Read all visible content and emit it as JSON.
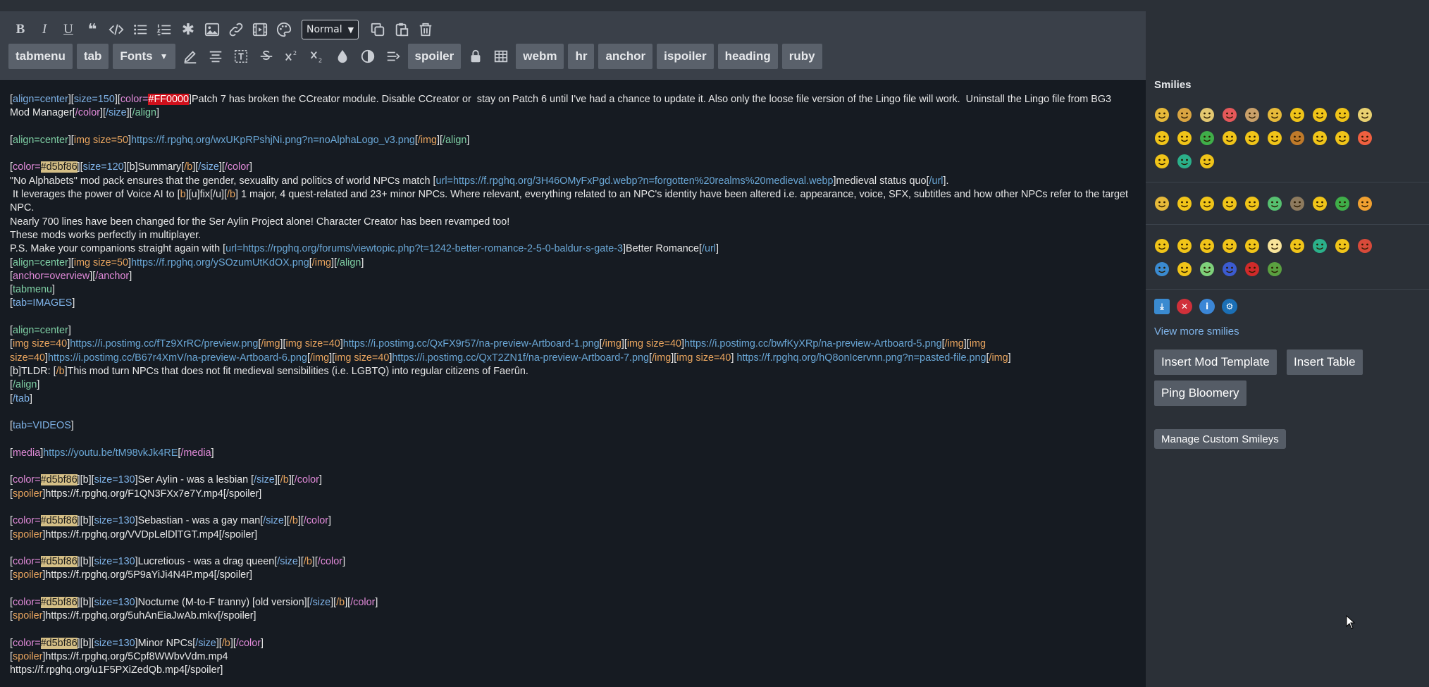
{
  "toolbar": {
    "row1_icons": [
      "bold-icon",
      "italic-icon",
      "underline-icon",
      "quote-icon",
      "code-icon",
      "bulleted-list-icon",
      "numbered-list-icon",
      "asterisk-icon",
      "image-icon",
      "link-icon",
      "video-icon",
      "palette-icon"
    ],
    "format_select": "Normal",
    "row1_right_icons": [
      "copy-icon",
      "paste-icon",
      "trash-icon"
    ],
    "row2": [
      {
        "type": "chip",
        "label": "tabmenu"
      },
      {
        "type": "chip",
        "label": "tab"
      },
      {
        "type": "chip",
        "label": "Fonts",
        "caret": true
      },
      {
        "type": "icon",
        "name": "pen-icon"
      },
      {
        "type": "icon",
        "name": "align-center-icon"
      },
      {
        "type": "icon",
        "name": "text-box-icon"
      },
      {
        "type": "icon",
        "name": "strikethrough-icon"
      },
      {
        "type": "icon",
        "name": "superscript-icon"
      },
      {
        "type": "icon",
        "name": "subscript-icon"
      },
      {
        "type": "icon",
        "name": "drop-icon"
      },
      {
        "type": "icon",
        "name": "contrast-icon"
      },
      {
        "type": "icon",
        "name": "indent-icon"
      },
      {
        "type": "chip",
        "label": "spoiler"
      },
      {
        "type": "icon",
        "name": "lock-icon"
      },
      {
        "type": "icon",
        "name": "table-icon"
      },
      {
        "type": "chip",
        "label": "webm"
      },
      {
        "type": "chip",
        "label": "hr"
      },
      {
        "type": "chip",
        "label": "anchor"
      },
      {
        "type": "chip",
        "label": "ispoiler"
      },
      {
        "type": "chip",
        "label": "heading"
      },
      {
        "type": "chip",
        "label": "ruby"
      }
    ]
  },
  "editor_lines": [
    [
      [
        "[",
        "w"
      ],
      [
        "align=center",
        "blue"
      ],
      [
        "][",
        "w"
      ],
      [
        "size=150",
        "blue"
      ],
      [
        "][",
        "w"
      ],
      [
        "color=",
        "pink"
      ],
      [
        "#FF0000",
        "red"
      ],
      [
        "]Patch 7 has broken the CCreator module. Disable CCreator or  stay on Patch 6 until I've had a chance to update it. Also only the loose file version of the Lingo file will work.  Uninstall the Lingo file from BG3 Mod Manager[",
        "w"
      ],
      [
        "/color",
        "pink"
      ],
      [
        "][",
        "w"
      ],
      [
        "/size",
        "blue"
      ],
      [
        "][",
        "w"
      ],
      [
        "/align",
        "green"
      ],
      [
        "]",
        "w"
      ]
    ],
    [],
    [
      [
        "[",
        "w"
      ],
      [
        "align=center",
        "green"
      ],
      [
        "][",
        "w"
      ],
      [
        "img size=50",
        "orange"
      ],
      [
        "]",
        "w"
      ],
      [
        "https://f.rpghq.org/wxUKpRPshjNi.png?n=noAlphaLogo_v3.png",
        "url"
      ],
      [
        "[",
        "w"
      ],
      [
        "/img",
        "orange"
      ],
      [
        "][",
        "w"
      ],
      [
        "/align",
        "green"
      ],
      [
        "]",
        "w"
      ]
    ],
    [],
    [
      [
        "[",
        "w"
      ],
      [
        "color=",
        "pink"
      ],
      [
        "#d5bf86",
        "hl"
      ],
      [
        "][",
        "w"
      ],
      [
        "size=120",
        "blue"
      ],
      [
        "][b]Summary[",
        "w"
      ],
      [
        "/b",
        "orange"
      ],
      [
        "][",
        "w"
      ],
      [
        "/size",
        "blue"
      ],
      [
        "][",
        "w"
      ],
      [
        "/color",
        "pink"
      ],
      [
        "]",
        "w"
      ]
    ],
    [
      [
        "\"No Alphabets\" mod pack ensures that the gender, sexuality and politics of world NPCs match [",
        "w"
      ],
      [
        "url=https://f.rpghq.org/3H46OMyFxPgd.webp?n=forgotten%20realms%20medieval.webp",
        "url"
      ],
      [
        "]medieval status quo[",
        "w"
      ],
      [
        "/url",
        "url"
      ],
      [
        "].",
        "w"
      ]
    ],
    [
      [
        " It leverages the power of Voice AI to [",
        "w"
      ],
      [
        "b",
        "orange"
      ],
      [
        "][u]fix[/u][",
        "w"
      ],
      [
        "/b",
        "orange"
      ],
      [
        "] 1 major, 4 quest-related and 23+ minor NPCs. Where relevant, everything related to an NPC's identity have been altered i.e. appearance, voice, SFX, subtitles and how other NPCs refer to the target NPC.",
        "w"
      ]
    ],
    [
      [
        "Nearly 700 lines have been changed for the Ser Aylin Project alone! Character Creator has been revamped too!",
        "w"
      ]
    ],
    [
      [
        "These mods works perfectly in multiplayer.",
        "w"
      ]
    ],
    [
      [
        "P.S. Make your companions straight again with [",
        "w"
      ],
      [
        "url=https://rpghq.org/forums/viewtopic.php?t=1242-better-romance-2-5-0-baldur-s-gate-3",
        "url"
      ],
      [
        "]Better Romance[",
        "w"
      ],
      [
        "/url",
        "url"
      ],
      [
        "]",
        "w"
      ]
    ],
    [
      [
        "[",
        "w"
      ],
      [
        "align=center",
        "green"
      ],
      [
        "][",
        "w"
      ],
      [
        "img size=50",
        "orange"
      ],
      [
        "]",
        "w"
      ],
      [
        "https://f.rpghq.org/ySOzumUtKdOX.png",
        "url"
      ],
      [
        "[",
        "w"
      ],
      [
        "/img",
        "orange"
      ],
      [
        "][",
        "w"
      ],
      [
        "/align",
        "green"
      ],
      [
        "]",
        "w"
      ]
    ],
    [
      [
        "[",
        "w"
      ],
      [
        "anchor=overview",
        "pink"
      ],
      [
        "][",
        "w"
      ],
      [
        "/anchor",
        "pink"
      ],
      [
        "]",
        "w"
      ]
    ],
    [
      [
        "[",
        "w"
      ],
      [
        "tabmenu",
        "green"
      ],
      [
        "]",
        "w"
      ]
    ],
    [
      [
        "[",
        "w"
      ],
      [
        "tab=IMAGES",
        "blue"
      ],
      [
        "]",
        "w"
      ]
    ],
    [],
    [
      [
        "[",
        "w"
      ],
      [
        "align=center",
        "green"
      ],
      [
        "]",
        "w"
      ]
    ],
    [
      [
        "[",
        "w"
      ],
      [
        "img size=40",
        "orange"
      ],
      [
        "]",
        "w"
      ],
      [
        "https://i.postimg.cc/fTz9XrRC/preview.png",
        "url"
      ],
      [
        "[",
        "w"
      ],
      [
        "/img",
        "orange"
      ],
      [
        "][",
        "w"
      ],
      [
        "img size=40",
        "orange"
      ],
      [
        "]",
        "w"
      ],
      [
        "https://i.postimg.cc/QxFX9r57/na-preview-Artboard-1.png",
        "url"
      ],
      [
        "[",
        "w"
      ],
      [
        "/img",
        "orange"
      ],
      [
        "][",
        "w"
      ],
      [
        "img size=40",
        "orange"
      ],
      [
        "]",
        "w"
      ],
      [
        "https://i.postimg.cc/bwfKyXRp/na-preview-Artboard-5.png",
        "url"
      ],
      [
        "[",
        "w"
      ],
      [
        "/img",
        "orange"
      ],
      [
        "][",
        "w"
      ],
      [
        "img size=40",
        "orange"
      ],
      [
        "]",
        "w"
      ],
      [
        "https://i.postimg.cc/B67r4XmV/na-preview-Artboard-6.png",
        "url"
      ],
      [
        "[",
        "w"
      ],
      [
        "/img",
        "orange"
      ],
      [
        "][",
        "w"
      ],
      [
        "img size=40",
        "orange"
      ],
      [
        "]",
        "w"
      ],
      [
        "https://i.postimg.cc/QxT2ZN1f/na-preview-Artboard-7.png",
        "url"
      ],
      [
        "[",
        "w"
      ],
      [
        "/img",
        "orange"
      ],
      [
        "][",
        "w"
      ],
      [
        "img size=40",
        "orange"
      ],
      [
        "] ",
        "w"
      ],
      [
        "https://f.rpghq.org/hQ8onIcervnn.png?n=pasted-file.png",
        "url"
      ],
      [
        "[",
        "w"
      ],
      [
        "/img",
        "orange"
      ],
      [
        "]",
        "w"
      ]
    ],
    [
      [
        "[b]TLDR: [",
        "w"
      ],
      [
        "/b",
        "orange"
      ],
      [
        "]This mod turn NPCs that does not fit medieval sensibilities (i.e. LGBTQ) into regular citizens of Faerûn.",
        "w"
      ]
    ],
    [
      [
        "[",
        "w"
      ],
      [
        "/align",
        "green"
      ],
      [
        "]",
        "w"
      ]
    ],
    [
      [
        "[",
        "w"
      ],
      [
        "/tab",
        "blue"
      ],
      [
        "]",
        "w"
      ]
    ],
    [],
    [
      [
        "[",
        "w"
      ],
      [
        "tab=VIDEOS",
        "blue"
      ],
      [
        "]",
        "w"
      ]
    ],
    [],
    [
      [
        "[",
        "w"
      ],
      [
        "media",
        "pink"
      ],
      [
        "]",
        "w"
      ],
      [
        "https://youtu.be/tM98vkJk4RE",
        "url"
      ],
      [
        "[",
        "w"
      ],
      [
        "/media",
        "pink"
      ],
      [
        "]",
        "w"
      ]
    ],
    [],
    [
      [
        "[",
        "w"
      ],
      [
        "color=",
        "pink"
      ],
      [
        "#d5bf86",
        "hl"
      ],
      [
        "][b][",
        "w"
      ],
      [
        "size=130",
        "blue"
      ],
      [
        "]Ser Aylin - was a lesbian [",
        "w"
      ],
      [
        "/size",
        "blue"
      ],
      [
        "][",
        "w"
      ],
      [
        "/b",
        "orange"
      ],
      [
        "][",
        "w"
      ],
      [
        "/color",
        "pink"
      ],
      [
        "]",
        "w"
      ]
    ],
    [
      [
        "[",
        "w"
      ],
      [
        "spoiler",
        "orange"
      ],
      [
        "]https://f.rpghq.org/F1QN3FXx7e7Y.mp4[/spoiler]",
        "w"
      ]
    ],
    [],
    [
      [
        "[",
        "w"
      ],
      [
        "color=",
        "pink"
      ],
      [
        "#d5bf86",
        "hl"
      ],
      [
        "][b][",
        "w"
      ],
      [
        "size=130",
        "blue"
      ],
      [
        "]Sebastian - was a gay man[",
        "w"
      ],
      [
        "/size",
        "blue"
      ],
      [
        "][",
        "w"
      ],
      [
        "/b",
        "orange"
      ],
      [
        "][",
        "w"
      ],
      [
        "/color",
        "pink"
      ],
      [
        "]",
        "w"
      ]
    ],
    [
      [
        "[",
        "w"
      ],
      [
        "spoiler",
        "orange"
      ],
      [
        "]https://f.rpghq.org/VVDpLelDlTGT.mp4[/spoiler]",
        "w"
      ]
    ],
    [],
    [
      [
        "[",
        "w"
      ],
      [
        "color=",
        "pink"
      ],
      [
        "#d5bf86",
        "hl"
      ],
      [
        "][b][",
        "w"
      ],
      [
        "size=130",
        "blue"
      ],
      [
        "]Lucretious - was a drag queen[",
        "w"
      ],
      [
        "/size",
        "blue"
      ],
      [
        "][",
        "w"
      ],
      [
        "/b",
        "orange"
      ],
      [
        "][",
        "w"
      ],
      [
        "/color",
        "pink"
      ],
      [
        "]",
        "w"
      ]
    ],
    [
      [
        "[",
        "w"
      ],
      [
        "spoiler",
        "orange"
      ],
      [
        "]https://f.rpghq.org/5P9aYiJi4N4P.mp4[/spoiler]",
        "w"
      ]
    ],
    [],
    [
      [
        "[",
        "w"
      ],
      [
        "color=",
        "pink"
      ],
      [
        "#d5bf86",
        "hl"
      ],
      [
        "][b][",
        "w"
      ],
      [
        "size=130",
        "blue"
      ],
      [
        "]Nocturne (M-to-F tranny) [old version][",
        "w"
      ],
      [
        "/size",
        "blue"
      ],
      [
        "][",
        "w"
      ],
      [
        "/b",
        "orange"
      ],
      [
        "][",
        "w"
      ],
      [
        "/color",
        "pink"
      ],
      [
        "]",
        "w"
      ]
    ],
    [
      [
        "[",
        "w"
      ],
      [
        "spoiler",
        "orange"
      ],
      [
        "]https://f.rpghq.org/5uhAnEiaJwAb.mkv[/spoiler]",
        "w"
      ]
    ],
    [],
    [
      [
        "[",
        "w"
      ],
      [
        "color=",
        "pink"
      ],
      [
        "#d5bf86",
        "hl"
      ],
      [
        "][b][",
        "w"
      ],
      [
        "size=130",
        "blue"
      ],
      [
        "]Minor NPCs[",
        "w"
      ],
      [
        "/size",
        "blue"
      ],
      [
        "][",
        "w"
      ],
      [
        "/b",
        "orange"
      ],
      [
        "][",
        "w"
      ],
      [
        "/color",
        "pink"
      ],
      [
        "]",
        "w"
      ]
    ],
    [
      [
        "[",
        "w"
      ],
      [
        "spoiler",
        "orange"
      ],
      [
        "]https://f.rpghq.org/5Cpf8WWbvVdm.mp4",
        "w"
      ]
    ],
    [
      [
        "https://f.rpghq.org/u1F5PXiZedQb.mp4[/spoiler]",
        "w"
      ]
    ]
  ],
  "sidebar": {
    "title": "Smilies",
    "group1": [
      "#e6b93a",
      "#d9a441",
      "#e3c770",
      "#e5585a",
      "#c9a06a",
      "#e6b93a",
      "#f0c419",
      "#f0c419",
      "#f0c419",
      "#e8d070",
      "#f0c419",
      "#f0c419",
      "#3fae49",
      "#f0c419",
      "#f0c419",
      "#f0c419",
      "#c07a2a",
      "#f0c419",
      "#f0c419",
      "#f06040",
      "#f0c419",
      "#2bb08a",
      "#f0c419"
    ],
    "group2": [
      "#e6b93a",
      "#f0c419",
      "#f0c419",
      "#f0c419",
      "#f0c419",
      "#56c070",
      "#8d7a5e",
      "#f0c419",
      "#3fae49",
      "#f0a030"
    ],
    "group3": [
      "#f0c419",
      "#f0c419",
      "#f0c419",
      "#f0c419",
      "#f0c419",
      "#f7e39a",
      "#f0c419",
      "#2bb08a",
      "#f0c419",
      "#d84a3a",
      "#3a8ad0",
      "#f0c419",
      "#7ed07a",
      "#3b5bd0",
      "#d02a2a",
      "#5aa040"
    ],
    "group4": [
      {
        "name": "download-icon",
        "color": "#3a8ad0",
        "glyph": "⤓"
      },
      {
        "name": "close-circle-icon",
        "color": "#d0303a",
        "glyph": "✕"
      },
      {
        "name": "info-circle-icon",
        "color": "#3b86d6",
        "glyph": "i"
      },
      {
        "name": "steam-icon",
        "color": "#1b6fb5",
        "glyph": "⚙"
      }
    ],
    "view_more": "View more smilies",
    "insert_mod_template": "Insert Mod Template",
    "insert_table": "Insert Table",
    "ping_bloomery": "Ping Bloomery",
    "manage_custom_smileys": "Manage Custom Smileys"
  }
}
